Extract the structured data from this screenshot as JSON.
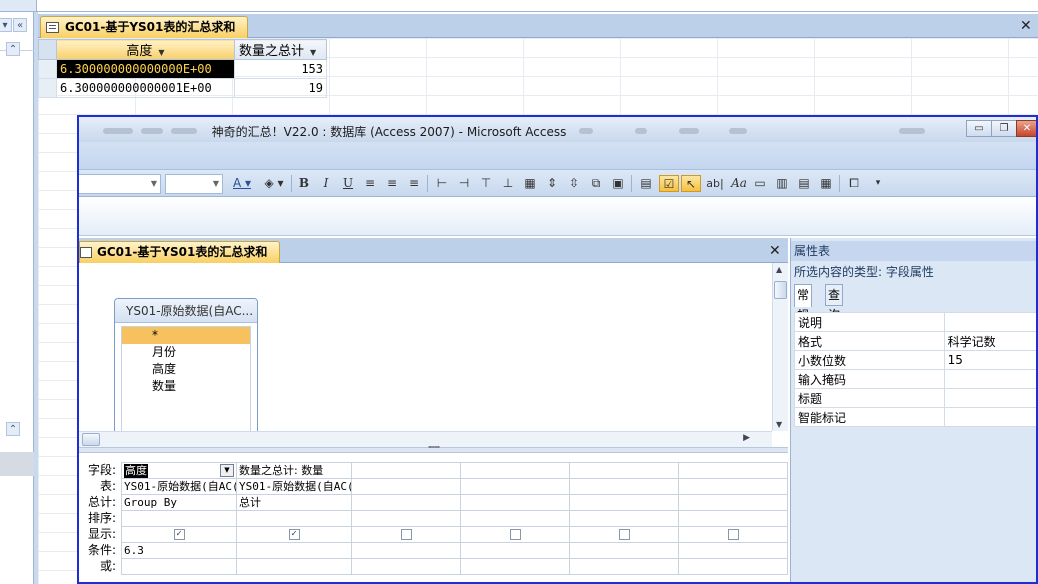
{
  "datasheet": {
    "tab_title": "GC01-基于YS01表的汇总求和",
    "columns": [
      "高度",
      "数量之总计"
    ],
    "rows": [
      {
        "height": "6.300000000000000E+00",
        "count": "153"
      },
      {
        "height": "6.300000000000001E+00",
        "count": "19"
      }
    ]
  },
  "nav": {
    "collapse_label": "«",
    "menu_label": "▾",
    "up_label": "⌃"
  },
  "window": {
    "title": "神奇的汇总！V22.0 : 数据库 (Access 2007) - Microsoft Access"
  },
  "toolbar": {
    "icons": [
      "font-color-icon",
      "fill-color-icon",
      "bold-icon",
      "italic-icon",
      "underline-icon",
      "align-left-icon",
      "align-center-icon",
      "align-right-icon",
      "select-icon",
      "textbox-icon",
      "label-icon"
    ]
  },
  "query": {
    "tab_title": "GC01-基于YS01表的汇总求和",
    "table_name": "YS01-原始数据(自AC...",
    "fields": [
      "*",
      "月份",
      "高度",
      "数量"
    ],
    "row_labels": [
      "字段:",
      "表:",
      "总计:",
      "排序:",
      "显示:",
      "条件:",
      "或:"
    ],
    "columns": [
      {
        "field": "高度",
        "table": "YS01-原始数据(自AC(",
        "total": "Group By",
        "sort": "",
        "show": true,
        "criteria": "6.3",
        "or": ""
      },
      {
        "field": "数量之总计: 数量",
        "table": "YS01-原始数据(自AC(",
        "total": "总计",
        "sort": "",
        "show": true,
        "criteria": "",
        "or": ""
      },
      {
        "field": "",
        "table": "",
        "total": "",
        "sort": "",
        "show": false,
        "criteria": "",
        "or": ""
      },
      {
        "field": "",
        "table": "",
        "total": "",
        "sort": "",
        "show": false,
        "criteria": "",
        "or": ""
      },
      {
        "field": "",
        "table": "",
        "total": "",
        "sort": "",
        "show": false,
        "criteria": "",
        "or": ""
      },
      {
        "field": "",
        "table": "",
        "total": "",
        "sort": "",
        "show": false,
        "criteria": "",
        "or": ""
      }
    ]
  },
  "property_sheet": {
    "title": "属性表",
    "selection_type": "所选内容的类型: 字段属性",
    "tabs": [
      "常规",
      "查询"
    ],
    "properties": [
      {
        "name": "说明",
        "value": ""
      },
      {
        "name": "格式",
        "value": "科学记数"
      },
      {
        "name": "小数位数",
        "value": "15"
      },
      {
        "name": "输入掩码",
        "value": ""
      },
      {
        "name": "标题",
        "value": ""
      },
      {
        "name": "智能标记",
        "value": ""
      }
    ]
  },
  "colors": {
    "accent_border": "#1d2fd3",
    "tab_gold": "#f8cf63",
    "selection_black": "#000000",
    "selection_text": "#ffd34f"
  }
}
